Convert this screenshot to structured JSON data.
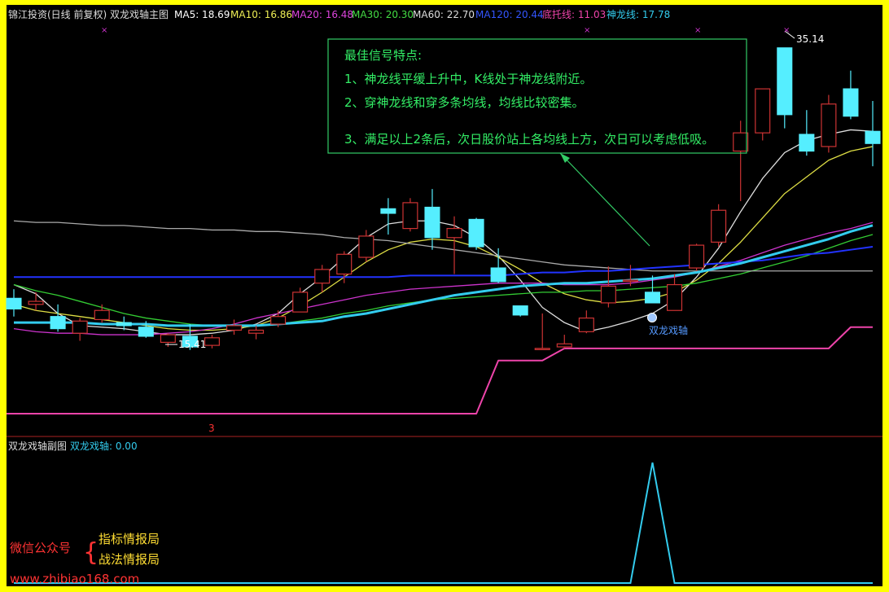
{
  "main_header": {
    "title": "锦江投资(日线 前复权) 双龙戏轴主图",
    "ma5": "MA5: 18.69",
    "ma10": "MA10: 16.86",
    "ma20": "MA20: 16.48",
    "ma30": "MA30: 20.30",
    "ma60": "MA60: 22.70",
    "ma120": "MA120: 20.44",
    "ditu": "底托线: 11.03",
    "shenlong": "神龙线: 17.78"
  },
  "sub_header": {
    "title": "双龙戏轴副图",
    "indicator": "双龙戏轴: 0.00"
  },
  "annotation": {
    "title": "最佳信号特点:",
    "line1": "1、神龙线平缓上升中，K线处于神龙线附近。",
    "line2": "2、穿神龙线和穿多条均线，均线比较密集。",
    "line3": "3、满足以上2条后，次日股价站上各均线上方，次日可以考虑低吸。"
  },
  "labels": {
    "high": "35.14",
    "low": "15.41",
    "signal": "双龙戏轴",
    "marker": "3"
  },
  "watermark": {
    "wechat": "微信公众号",
    "brace": "{",
    "name1": "指标情报局",
    "name2": "战法情报局",
    "url": "www.zhibiao168.com"
  },
  "colors": {
    "background": "#000000",
    "frame": "#ffff00",
    "up": "#cc3333",
    "down": "#55eeff",
    "ma5": "#dddddd",
    "ma10": "#dddd44",
    "ma20": "#cc33cc",
    "ma30": "#33cc33",
    "ma60": "#aaaaaa",
    "ma120": "#2233ff",
    "ditu": "#ee44aa",
    "shenlong": "#33ccee",
    "annotation": "#33ee66"
  },
  "chart_data": [
    {
      "type": "candlestick",
      "title": "锦江投资(日线 前复权) 双龙戏轴主图",
      "ylim": [
        11,
        36
      ],
      "candles": [
        {
          "o": 18.6,
          "h": 19.2,
          "l": 17.4,
          "c": 17.9
        },
        {
          "o": 18.2,
          "h": 19.0,
          "l": 17.8,
          "c": 18.4
        },
        {
          "o": 17.4,
          "h": 18.2,
          "l": 16.4,
          "c": 16.6
        },
        {
          "o": 16.3,
          "h": 17.3,
          "l": 15.8,
          "c": 17.1
        },
        {
          "o": 17.2,
          "h": 18.2,
          "l": 17.0,
          "c": 17.8
        },
        {
          "o": 17.0,
          "h": 17.4,
          "l": 16.5,
          "c": 16.8
        },
        {
          "o": 16.7,
          "h": 17.1,
          "l": 16.0,
          "c": 16.1
        },
        {
          "o": 15.7,
          "h": 16.3,
          "l": 15.4,
          "c": 16.2
        },
        {
          "o": 16.1,
          "h": 16.9,
          "l": 15.2,
          "c": 15.4
        },
        {
          "o": 15.5,
          "h": 16.2,
          "l": 15.3,
          "c": 16.0
        },
        {
          "o": 16.5,
          "h": 17.2,
          "l": 16.2,
          "c": 16.8
        },
        {
          "o": 16.3,
          "h": 16.8,
          "l": 15.9,
          "c": 16.5
        },
        {
          "o": 16.9,
          "h": 17.8,
          "l": 16.7,
          "c": 17.4
        },
        {
          "o": 17.7,
          "h": 19.3,
          "l": 17.7,
          "c": 19.0
        },
        {
          "o": 19.6,
          "h": 20.8,
          "l": 19.0,
          "c": 20.5
        },
        {
          "o": 20.2,
          "h": 21.7,
          "l": 19.6,
          "c": 21.5
        },
        {
          "o": 21.3,
          "h": 23.1,
          "l": 21.0,
          "c": 22.7
        },
        {
          "o": 24.5,
          "h": 25.2,
          "l": 22.8,
          "c": 24.2
        },
        {
          "o": 23.2,
          "h": 25.2,
          "l": 23.0,
          "c": 24.9
        },
        {
          "o": 24.6,
          "h": 25.8,
          "l": 21.8,
          "c": 22.6
        },
        {
          "o": 22.6,
          "h": 24.0,
          "l": 20.2,
          "c": 23.2
        },
        {
          "o": 23.8,
          "h": 23.9,
          "l": 21.8,
          "c": 22.0
        },
        {
          "o": 20.6,
          "h": 21.9,
          "l": 19.6,
          "c": 19.7
        },
        {
          "o": 18.1,
          "h": 18.1,
          "l": 17.4,
          "c": 17.5
        },
        {
          "o": 15.3,
          "h": 17.6,
          "l": 15.2,
          "c": 15.3
        },
        {
          "o": 15.4,
          "h": 16.2,
          "l": 15.3,
          "c": 15.6
        },
        {
          "o": 16.4,
          "h": 17.8,
          "l": 16.3,
          "c": 17.3
        },
        {
          "o": 18.3,
          "h": 20.7,
          "l": 18.0,
          "c": 19.4
        },
        {
          "o": 19.8,
          "h": 20.8,
          "l": 19.4,
          "c": 19.8
        },
        {
          "o": 19.0,
          "h": 20.1,
          "l": 18.3,
          "c": 18.3
        },
        {
          "o": 17.8,
          "h": 20.2,
          "l": 17.8,
          "c": 19.5
        },
        {
          "o": 20.6,
          "h": 22.2,
          "l": 20.4,
          "c": 22.1
        },
        {
          "o": 22.3,
          "h": 24.8,
          "l": 22.0,
          "c": 24.4
        },
        {
          "o": 28.3,
          "h": 30.3,
          "l": 25.0,
          "c": 29.5
        },
        {
          "o": 29.5,
          "h": 32.4,
          "l": 29.0,
          "c": 32.4
        },
        {
          "o": 35.1,
          "h": 35.1,
          "l": 29.8,
          "c": 30.7
        },
        {
          "o": 29.4,
          "h": 31.0,
          "l": 28.0,
          "c": 28.3
        },
        {
          "o": 28.6,
          "h": 32.0,
          "l": 28.2,
          "c": 31.4
        },
        {
          "o": 32.4,
          "h": 33.6,
          "l": 30.4,
          "c": 30.6
        },
        {
          "o": 29.6,
          "h": 31.6,
          "l": 27.3,
          "c": 28.8
        }
      ],
      "series": [
        {
          "name": "MA5",
          "values": [
            19.5,
            18.9,
            17.6,
            16.8,
            16.7,
            16.6,
            16.4,
            16.2,
            16.2,
            16.3,
            16.5,
            16.9,
            17.6,
            18.9,
            20.0,
            21.3,
            22.6,
            23.5,
            23.7,
            23.7,
            23.4,
            22.6,
            21.4,
            19.8,
            18.0,
            17.0,
            16.4,
            16.7,
            17.1,
            17.6,
            18.5,
            20.0,
            21.9,
            24.3,
            26.5,
            28.2,
            29.0,
            29.4,
            29.7,
            29.6
          ]
        },
        {
          "name": "MA10",
          "values": [
            18.2,
            17.8,
            17.6,
            17.4,
            17.2,
            17.0,
            16.8,
            16.6,
            16.5,
            16.5,
            16.6,
            16.8,
            17.3,
            18.1,
            19.0,
            20.0,
            21.0,
            21.8,
            22.3,
            22.5,
            22.4,
            22.0,
            21.3,
            20.5,
            19.6,
            18.9,
            18.5,
            18.3,
            18.4,
            18.6,
            19.0,
            19.8,
            20.9,
            22.3,
            23.9,
            25.5,
            26.6,
            27.7,
            28.3,
            28.6
          ]
        },
        {
          "name": "MA20",
          "values": [
            16.6,
            16.4,
            16.3,
            16.3,
            16.2,
            16.2,
            16.2,
            16.3,
            16.4,
            16.6,
            16.9,
            17.3,
            17.6,
            17.9,
            18.2,
            18.5,
            18.8,
            19.0,
            19.2,
            19.3,
            19.4,
            19.5,
            19.6,
            19.6,
            19.6,
            19.5,
            19.5,
            19.5,
            19.6,
            19.8,
            20.0,
            20.3,
            20.7,
            21.1,
            21.6,
            22.1,
            22.5,
            22.9,
            23.2,
            23.6
          ]
        },
        {
          "name": "MA30",
          "values": [
            19.5,
            19.1,
            18.8,
            18.4,
            18.0,
            17.6,
            17.3,
            17.1,
            16.9,
            16.8,
            16.8,
            16.8,
            16.9,
            17.1,
            17.3,
            17.6,
            17.8,
            18.1,
            18.3,
            18.5,
            18.6,
            18.7,
            18.8,
            18.9,
            19.0,
            19.0,
            19.1,
            19.1,
            19.2,
            19.3,
            19.4,
            19.6,
            19.9,
            20.2,
            20.6,
            21.0,
            21.4,
            21.9,
            22.4,
            22.8
          ]
        },
        {
          "name": "MA60",
          "values": [
            23.7,
            23.6,
            23.6,
            23.5,
            23.4,
            23.4,
            23.3,
            23.2,
            23.2,
            23.1,
            23.1,
            23.0,
            23.0,
            22.9,
            22.8,
            22.6,
            22.5,
            22.4,
            22.2,
            22.0,
            21.8,
            21.6,
            21.4,
            21.2,
            21.0,
            20.8,
            20.7,
            20.6,
            20.5,
            20.4,
            20.4,
            20.4,
            20.4,
            20.4,
            20.4,
            20.4,
            20.4,
            20.4,
            20.4,
            20.4
          ]
        },
        {
          "name": "MA120",
          "values": [
            20.0,
            20.0,
            20.0,
            20.0,
            20.0,
            20.0,
            20.0,
            20.0,
            20.0,
            20.0,
            20.0,
            20.0,
            20.0,
            20.0,
            20.0,
            20.0,
            20.0,
            20.0,
            20.1,
            20.1,
            20.1,
            20.1,
            20.1,
            20.2,
            20.3,
            20.3,
            20.4,
            20.4,
            20.5,
            20.6,
            20.7,
            20.8,
            20.9,
            21.0,
            21.1,
            21.3,
            21.5,
            21.6,
            21.8,
            22.0
          ]
        },
        {
          "name": "神龙线",
          "values": [
            17.0,
            17.0,
            17.0,
            17.0,
            16.9,
            16.9,
            16.9,
            16.8,
            16.8,
            16.8,
            16.8,
            16.8,
            16.9,
            17.0,
            17.1,
            17.4,
            17.6,
            17.9,
            18.2,
            18.5,
            18.8,
            19.0,
            19.2,
            19.4,
            19.5,
            19.6,
            19.6,
            19.7,
            19.8,
            19.9,
            20.1,
            20.3,
            20.6,
            20.9,
            21.3,
            21.7,
            22.1,
            22.5,
            23.0,
            23.4
          ]
        },
        {
          "name": "底托线",
          "values": [
            11.0,
            11.0,
            11.0,
            11.0,
            11.0,
            11.0,
            11.0,
            11.0,
            11.0,
            11.0,
            11.0,
            11.0,
            11.0,
            11.0,
            11.0,
            11.0,
            11.0,
            11.0,
            11.0,
            11.0,
            11.0,
            11.0,
            14.5,
            14.5,
            14.5,
            15.3,
            15.3,
            15.3,
            15.3,
            15.3,
            15.3,
            15.3,
            15.3,
            15.3,
            15.3,
            15.3,
            15.3,
            15.3,
            16.7,
            16.7
          ]
        }
      ]
    },
    {
      "type": "line",
      "title": "双龙戏轴副图",
      "series": [
        {
          "name": "双龙戏轴",
          "values": [
            0,
            0,
            0,
            0,
            0,
            0,
            0,
            0,
            0,
            0,
            0,
            0,
            0,
            0,
            0,
            0,
            0,
            0,
            0,
            0,
            0,
            0,
            0,
            0,
            0,
            0,
            0,
            0,
            0,
            1,
            0,
            0,
            0,
            0,
            0,
            0,
            0,
            0,
            0,
            0
          ]
        }
      ]
    }
  ]
}
